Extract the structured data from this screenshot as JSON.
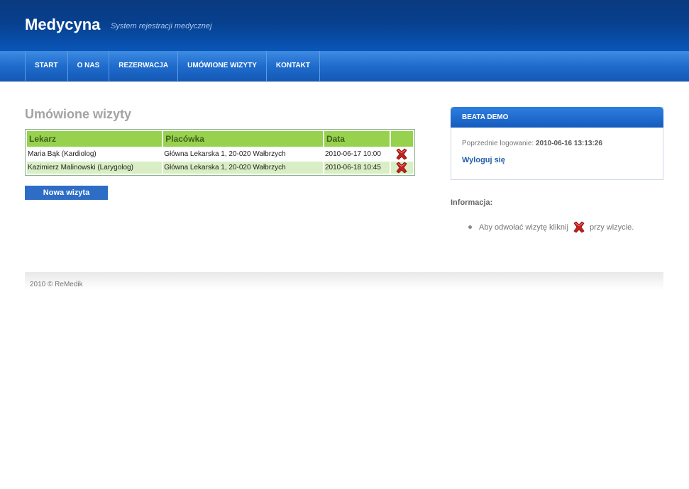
{
  "header": {
    "title": "Medycyna",
    "subtitle": "System rejestracji medycznej"
  },
  "nav": {
    "items": [
      {
        "label": "START"
      },
      {
        "label": "O NAS"
      },
      {
        "label": "REZERWACJA"
      },
      {
        "label": "UMÓWIONE WIZYTY"
      },
      {
        "label": "KONTAKT"
      }
    ]
  },
  "main": {
    "heading": "Umówione wizyty",
    "table": {
      "headers": [
        "Lekarz",
        "Placówka",
        "Data",
        ""
      ],
      "rows": [
        {
          "doctor": "Maria Bąk (Kardiolog)",
          "clinic": "Główna Lekarska 1, 20-020 Wałbrzych",
          "date": "2010-06-17 10:00",
          "action_icon": "delete-x-icon"
        },
        {
          "doctor": "Kazimierz Malinowski (Larygolog)",
          "clinic": "Główna Lekarska 1, 20-020 Wałbrzych",
          "date": "2010-06-18 10:45",
          "action_icon": "delete-x-icon"
        }
      ]
    },
    "new_visit_label": "Nowa wizyta"
  },
  "sidebar": {
    "user_name": "BEATA DEMO",
    "last_login_label": "Poprzednie logowanie:",
    "last_login_value": "2010-06-16 13:13:26",
    "logout_label": "Wyloguj się",
    "info_title": "Informacja:",
    "info_text_before": "Aby odwołać wizytę kliknij",
    "info_text_after": "przy wizycie."
  },
  "footer": {
    "text": "2010 © ReMedik"
  },
  "colors": {
    "header_dark": "#07408f",
    "nav_blue": "#1f6ccd",
    "table_header": "#96d24d",
    "table_alt_row": "#d9eec4",
    "delete_red": "#c8201e"
  }
}
